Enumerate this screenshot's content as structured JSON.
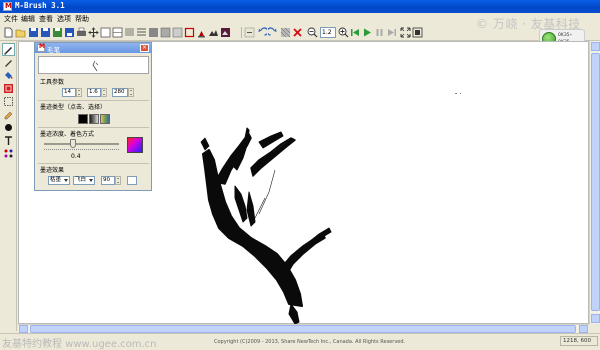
{
  "window": {
    "title": "M-Brush 3.1"
  },
  "menu": [
    "文件",
    "编辑",
    "查看",
    "选项",
    "帮助"
  ],
  "toolbar": {
    "zoom_value": "1.2"
  },
  "watermarks": {
    "top": "© 万峣 · 友基科技",
    "bottom": "友基特约教程 www.ugee.com.cn"
  },
  "nav": {
    "value1": "0K35",
    "value2": "0K35"
  },
  "brush_panel": {
    "title": "毛笔",
    "section_tool_params": "工具参数",
    "params": [
      "14",
      "1.6",
      "280"
    ],
    "section_brush_type": "墨迹类型（点击、选择）",
    "section_ink": "墨迹浓度、着色方式",
    "ink_value": "0.4",
    "section_effect": "墨迹效果",
    "effect_dropdown1": "枯墨",
    "effect_dropdown2": "飞白",
    "effect_value": "90",
    "swatch_colors": [
      "#000000",
      "#3a3a3a",
      "#c07040",
      "#7a9a50"
    ]
  },
  "status": {
    "copyright": "Copyright (C)2009 - 2013, Share NewTech Inc., Canada.  All Rights Reserved.",
    "coords": "1218, 600"
  },
  "colors": {
    "titlebar": "#0a5ee6",
    "canvas": "#ffffff",
    "chrome": "#ece9d8"
  }
}
